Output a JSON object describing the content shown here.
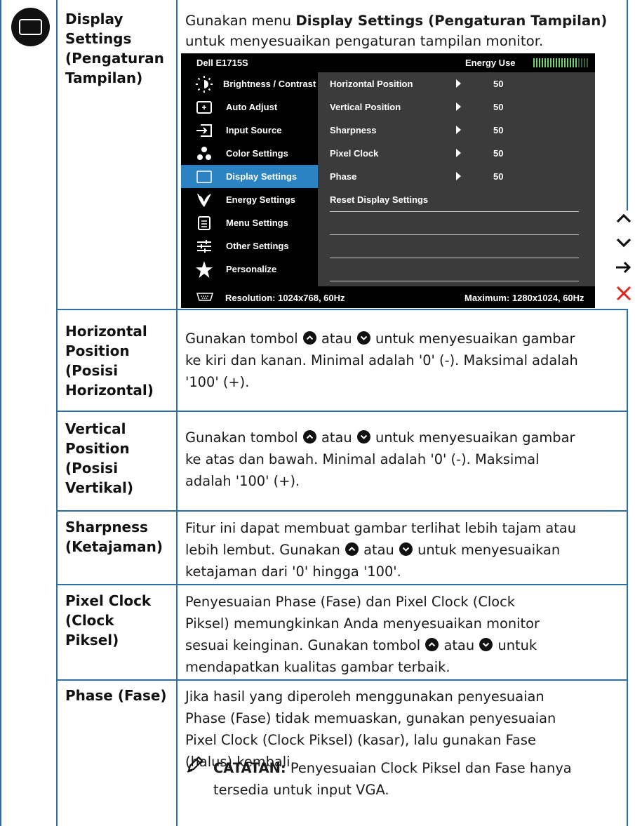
{
  "rows": [
    {
      "label": "Display Settings (Pengaturan Tampilan)",
      "label_lines": [
        "Display",
        "Settings",
        "(Pengaturan",
        "Tampilan)"
      ],
      "desc_pre": "Gunakan menu ",
      "desc_bold": "Display Settings (Pengaturan Tampilan)",
      "desc_post": " untuk menyesuaikan pengaturan tampilan monitor."
    },
    {
      "label_lines": [
        "Horizontal",
        "Position",
        "(Posisi",
        "Horizontal)"
      ],
      "desc_lines": [
        "Gunakan tombol {up} atau {down} untuk menyesuaikan gambar",
        "ke kiri dan kanan. Minimal adalah '0' (-). Maksimal adalah",
        "'100' (+)."
      ]
    },
    {
      "label_lines": [
        "Vertical",
        "Position",
        "(Posisi",
        "Vertikal)"
      ],
      "desc_lines": [
        "Gunakan tombol {up} atau {down} untuk menyesuaikan gambar",
        "ke atas dan bawah. Minimal adalah '0' (-). Maksimal",
        "adalah '100' (+)."
      ]
    },
    {
      "label_lines": [
        "Sharpness",
        "(Ketajaman)"
      ],
      "desc_lines": [
        "Fitur ini dapat membuat gambar terlihat lebih tajam atau",
        "lebih lembut. Gunakan {up} atau {down} untuk menyesuaikan",
        "ketajaman dari '0' hingga '100'."
      ]
    },
    {
      "label_lines": [
        "Pixel Clock",
        "(Clock",
        "Piksel)"
      ],
      "desc_lines": [
        "Penyesuaian Phase (Fase) dan Pixel Clock (Clock",
        "Piksel) memungkinkan Anda menyesuaikan monitor",
        "sesuai keinginan. Gunakan tombol {up} atau {down} untuk",
        "mendapatkan kualitas gambar terbaik."
      ]
    },
    {
      "label_lines": [
        "Phase (Fase)"
      ],
      "desc_lines": [
        "Jika hasil yang diperoleh menggunakan penyesuaian",
        "Phase (Fase) tidak memuaskan, gunakan penyesuaian",
        "Pixel Clock (Clock Piksel) (kasar), lalu gunakan Fase",
        "(halus) kembali."
      ],
      "note_label": "CATATAN:",
      "note_lines": [
        " Penyesuaian Clock Piksel dan Fase hanya",
        "tersedia untuk input VGA."
      ]
    }
  ],
  "osd": {
    "model": "Dell E1715S",
    "energy_label": "Energy Use",
    "energy_level": 0.78,
    "menu": [
      {
        "label": "Brightness / Contrast",
        "icon": "brightness-icon"
      },
      {
        "label": "Auto Adjust",
        "icon": "auto-adjust-icon"
      },
      {
        "label": "Input Source",
        "icon": "input-source-icon"
      },
      {
        "label": "Color Settings",
        "icon": "color-settings-icon"
      },
      {
        "label": "Display Settings",
        "icon": "display-settings-icon",
        "active": true
      },
      {
        "label": "Energy Settings",
        "icon": "energy-settings-icon"
      },
      {
        "label": "Menu Settings",
        "icon": "menu-settings-icon"
      },
      {
        "label": "Other Settings",
        "icon": "other-settings-icon"
      },
      {
        "label": "Personalize",
        "icon": "personalize-icon"
      }
    ],
    "submenu": [
      {
        "label": "Horizontal Position",
        "value": "50"
      },
      {
        "label": "Vertical Position",
        "value": "50"
      },
      {
        "label": "Sharpness",
        "value": "50"
      },
      {
        "label": "Pixel Clock",
        "value": "50"
      },
      {
        "label": "Phase",
        "value": "50"
      },
      {
        "label": "Reset Display Settings",
        "value": ""
      }
    ],
    "resolution": "Resolution: 1024x768, 60Hz",
    "maximum": "Maximum: 1280x1024, 60Hz"
  },
  "side_buttons": [
    "up-arrow-icon",
    "down-arrow-icon",
    "right-arrow-icon",
    "close-icon"
  ],
  "colors": {
    "border": "#2b6fa6",
    "highlight": "#2b83c3",
    "close": "#e0261b",
    "energy": "#6fd36f"
  }
}
